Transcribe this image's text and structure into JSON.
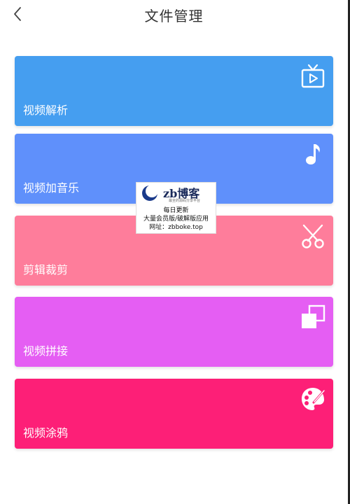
{
  "header": {
    "title": "文件管理"
  },
  "cards": [
    {
      "label": "视频解析",
      "color": "#459ef0",
      "icon": "tv-play-icon"
    },
    {
      "label": "视频加音乐",
      "color": "#5f90fb",
      "icon": "music-note-icon"
    },
    {
      "label": "剪辑裁剪",
      "color": "#fe7d9b",
      "icon": "scissors-icon"
    },
    {
      "label": "视频拼接",
      "color": "#e55ef3",
      "icon": "merge-squares-icon"
    },
    {
      "label": "视频涂鸦",
      "color": "#fd1f77",
      "icon": "palette-icon"
    }
  ],
  "watermark": {
    "brand": "zb博客",
    "tagline": "最全的源码分享平台",
    "line1": "每日更新",
    "line2": "大量会员版/破解版应用",
    "line3": "网址：zbboke.top"
  }
}
